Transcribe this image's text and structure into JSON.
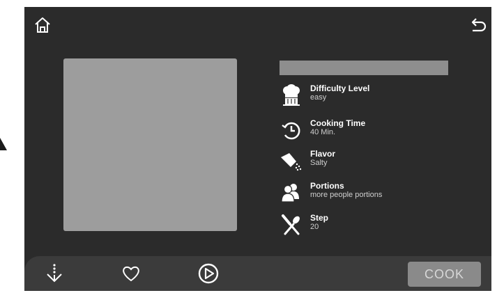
{
  "recipe": {
    "details": [
      {
        "icon": "chef-hat-icon",
        "label": "Difficulty Level",
        "value": "easy"
      },
      {
        "icon": "clock-icon",
        "label": "Cooking Time",
        "value": "40 Min."
      },
      {
        "icon": "salt-shaker-icon",
        "label": "Flavor",
        "value": "Salty"
      },
      {
        "icon": "people-icon",
        "label": "Portions",
        "value": "more people portions"
      },
      {
        "icon": "utensils-icon",
        "label": "Step",
        "value": "20"
      }
    ]
  },
  "bottom_bar": {
    "cook_label": "COOK"
  },
  "colors": {
    "screen_bg": "#2b2b2b",
    "bar_bg": "#3b3b3b",
    "image_placeholder": "#9d9d9d",
    "cook_button": "#8a8a8a"
  }
}
